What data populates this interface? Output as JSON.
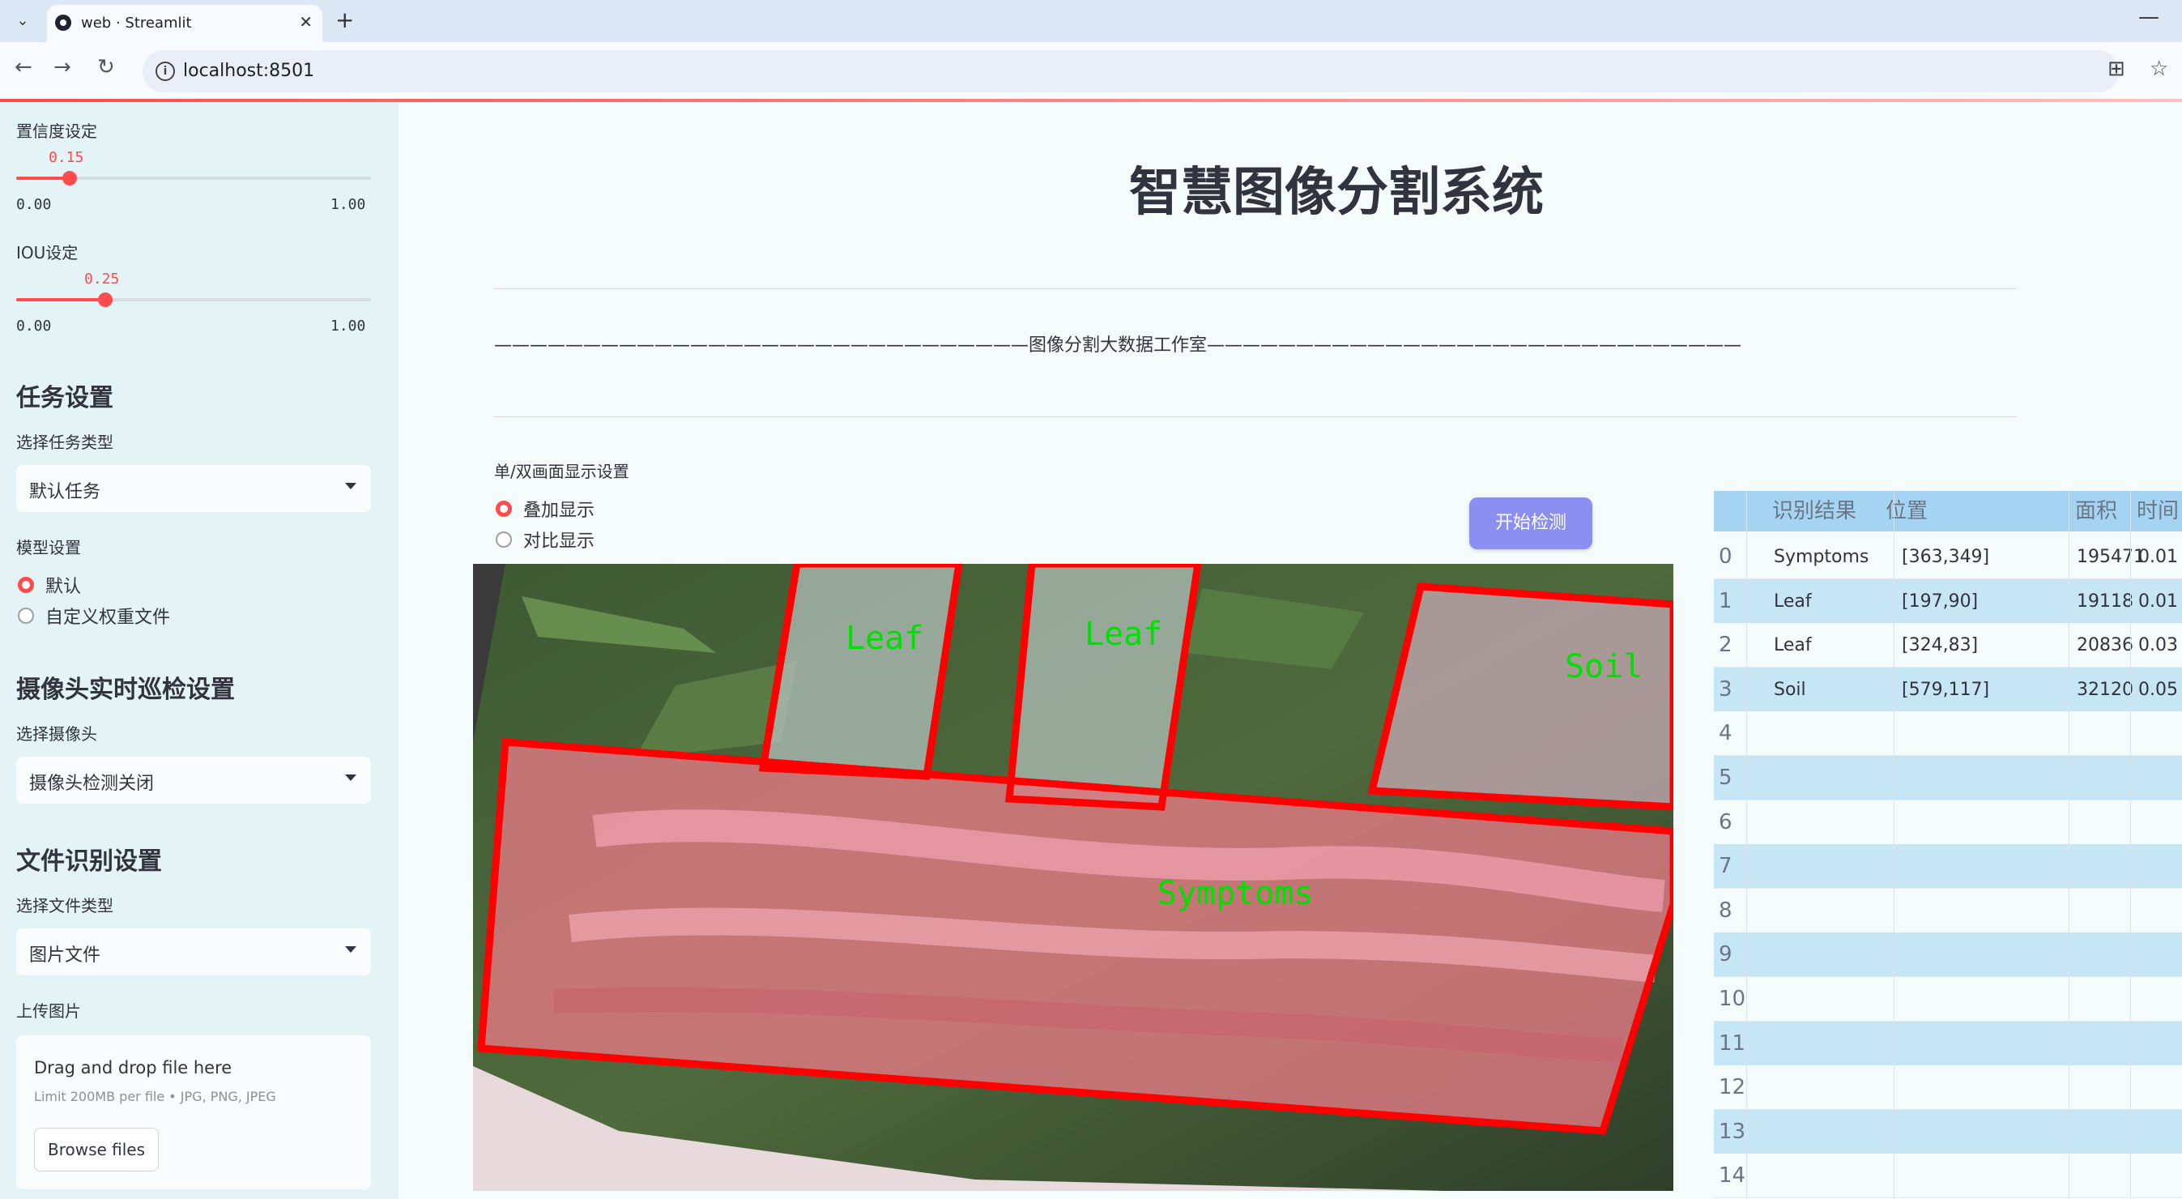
{
  "browser": {
    "tab_title": "web · Streamlit",
    "url": "localhost:8501"
  },
  "sidebar": {
    "confidence": {
      "label": "置信度设定",
      "value": "0.15",
      "min": "0.00",
      "max": "1.00",
      "fraction": 0.15
    },
    "iou": {
      "label": "IOU设定",
      "value": "0.25",
      "min": "0.00",
      "max": "1.00",
      "fraction": 0.25
    },
    "task_header": "任务设置",
    "task_type_label": "选择任务类型",
    "task_type_value": "默认任务",
    "model_label": "模型设置",
    "model_options": [
      "默认",
      "自定义权重文件"
    ],
    "model_selected": 0,
    "camera_header": "摄像头实时巡检设置",
    "camera_label": "选择摄像头",
    "camera_value": "摄像头检测关闭",
    "file_header": "文件识别设置",
    "file_type_label": "选择文件类型",
    "file_type_value": "图片文件",
    "upload_label": "上传图片",
    "upload_title": "Drag and drop file here",
    "upload_limit": "Limit 200MB per file • JPG, PNG, JPEG",
    "upload_button": "Browse files"
  },
  "main": {
    "title": "智慧图像分割系统",
    "divider_text": "——————————————————————————————图像分割大数据工作室——————————————————————————————",
    "display_label": "单/双画面显示设置",
    "display_options": [
      "叠加显示",
      "对比显示"
    ],
    "display_selected": 0,
    "run_button": "开始检测",
    "detections": [
      "Leaf",
      "Leaf",
      "Soil",
      "Symptoms"
    ]
  },
  "table": {
    "headers": [
      "",
      "识别结果",
      "位置",
      "面积",
      "时间"
    ],
    "rows": [
      [
        "0",
        "Symptoms",
        "[363,349]",
        "195471",
        "0.01"
      ],
      [
        "1",
        "Leaf",
        "[197,90]",
        "19118",
        "0.01"
      ],
      [
        "2",
        "Leaf",
        "[324,83]",
        "20836",
        "0.03"
      ],
      [
        "3",
        "Soil",
        "[579,117]",
        "32120",
        "0.05"
      ],
      [
        "4",
        "",
        "",
        "",
        ""
      ],
      [
        "5",
        "",
        "",
        "",
        ""
      ],
      [
        "6",
        "",
        "",
        "",
        ""
      ],
      [
        "7",
        "",
        "",
        "",
        ""
      ],
      [
        "8",
        "",
        "",
        "",
        ""
      ],
      [
        "9",
        "",
        "",
        "",
        ""
      ],
      [
        "10",
        "",
        "",
        "",
        ""
      ],
      [
        "11",
        "",
        "",
        "",
        ""
      ],
      [
        "12",
        "",
        "",
        "",
        ""
      ],
      [
        "13",
        "",
        "",
        "",
        ""
      ],
      [
        "14",
        "",
        "",
        "",
        ""
      ]
    ]
  },
  "colors": {
    "accent": "#ff4b4b",
    "button": "#8b8ff2",
    "table_header": "#a5d4f2",
    "table_stripe": "#c6e6f6",
    "box": "#ff0000",
    "label_text": "#00e000"
  }
}
